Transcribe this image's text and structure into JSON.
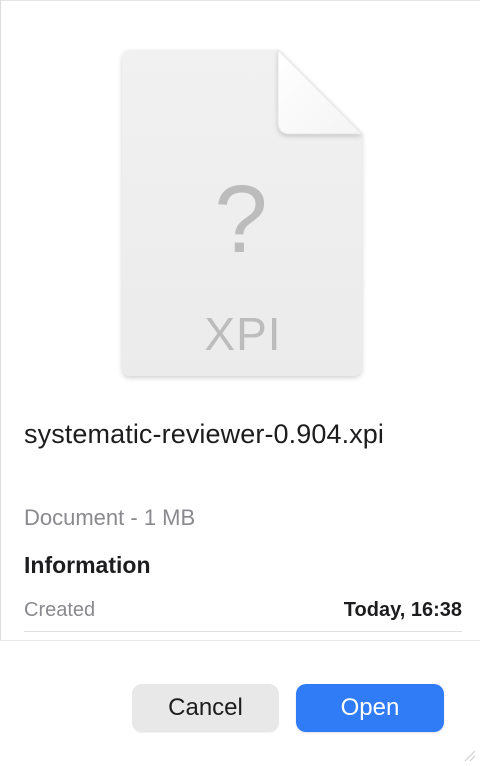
{
  "preview": {
    "icon": "unknown-file-document-icon",
    "glyph": "?",
    "extension_label": "XPI"
  },
  "file": {
    "name": "systematic-reviewer-0.904.xpi",
    "kind": "Document - 1 MB"
  },
  "information": {
    "title": "Information",
    "rows": [
      {
        "label": "Created",
        "value": "Today, 16:38"
      }
    ]
  },
  "buttons": {
    "cancel": "Cancel",
    "open": "Open"
  },
  "colors": {
    "accent": "#2f7cf6",
    "secondary_text": "#8a8a8e"
  }
}
